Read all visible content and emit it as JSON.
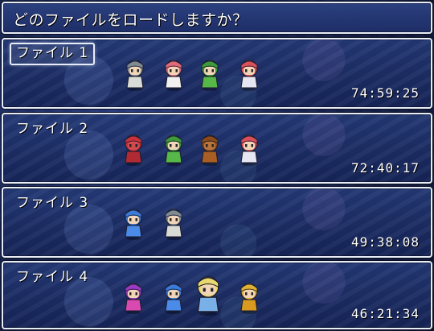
{
  "help": {
    "text": "どのファイルをロードしますか？"
  },
  "slots": [
    {
      "title": "ファイル 1",
      "playtime": "74:59:25",
      "selected": true,
      "party": [
        {
          "icon": "grey-haired-girl-sprite",
          "hair": "#7f8a93",
          "body": "#d9dcd6",
          "skin": "#f2d5b8"
        },
        {
          "icon": "pink-haired-girl-sprite",
          "hair": "#e06a7a",
          "body": "#f0f0f0",
          "skin": "#f2d5b8"
        },
        {
          "icon": "green-hat-girl-sprite",
          "hair": "#3e9a3a",
          "body": "#55b848",
          "skin": "#f2d5b8"
        },
        {
          "icon": "red-haired-girl-sprite",
          "hair": "#d8505a",
          "body": "#e6e6f2",
          "skin": "#f2d5b8"
        }
      ]
    },
    {
      "title": "ファイル 2",
      "playtime": "72:40:17",
      "selected": false,
      "party": [
        {
          "icon": "red-horned-demon-sprite",
          "hair": "#c8323c",
          "body": "#b02a34",
          "skin": "#d04a50"
        },
        {
          "icon": "green-hat-girl-sprite",
          "hair": "#3e9a3a",
          "body": "#55b848",
          "skin": "#f2d5b8"
        },
        {
          "icon": "brown-beast-sprite",
          "hair": "#8a4a1c",
          "body": "#a85e24",
          "skin": "#b8743a"
        },
        {
          "icon": "red-haired-girl-sprite",
          "hair": "#d8505a",
          "body": "#e6e6f2",
          "skin": "#f2d5b8"
        }
      ]
    },
    {
      "title": "ファイル 3",
      "playtime": "49:38:08",
      "selected": false,
      "party": [
        {
          "icon": "blue-haired-girl-sprite",
          "hair": "#3a7ad8",
          "body": "#4a8ae8",
          "skin": "#f2d5b8"
        },
        {
          "icon": "grey-haired-girl-sprite",
          "hair": "#7f8a93",
          "body": "#d9dcd6",
          "skin": "#f2d5b8"
        }
      ]
    },
    {
      "title": "ファイル 4",
      "playtime": "46:21:34",
      "selected": false,
      "party": [
        {
          "icon": "purple-haired-girl-sprite",
          "hair": "#9a3ac0",
          "body": "#d84ab0",
          "skin": "#f2d5b8"
        },
        {
          "icon": "blue-haired-girl-sprite",
          "hair": "#3a7ad8",
          "body": "#4a8ae8",
          "skin": "#f2d5b8"
        },
        {
          "icon": "blonde-large-girl-sprite",
          "hair": "#e8d870",
          "body": "#7ab0e8",
          "skin": "#f2d5b8"
        },
        {
          "icon": "blonde-girl-sprite",
          "hair": "#e0b030",
          "body": "#d89a20",
          "skin": "#f2d5b8"
        }
      ]
    }
  ]
}
